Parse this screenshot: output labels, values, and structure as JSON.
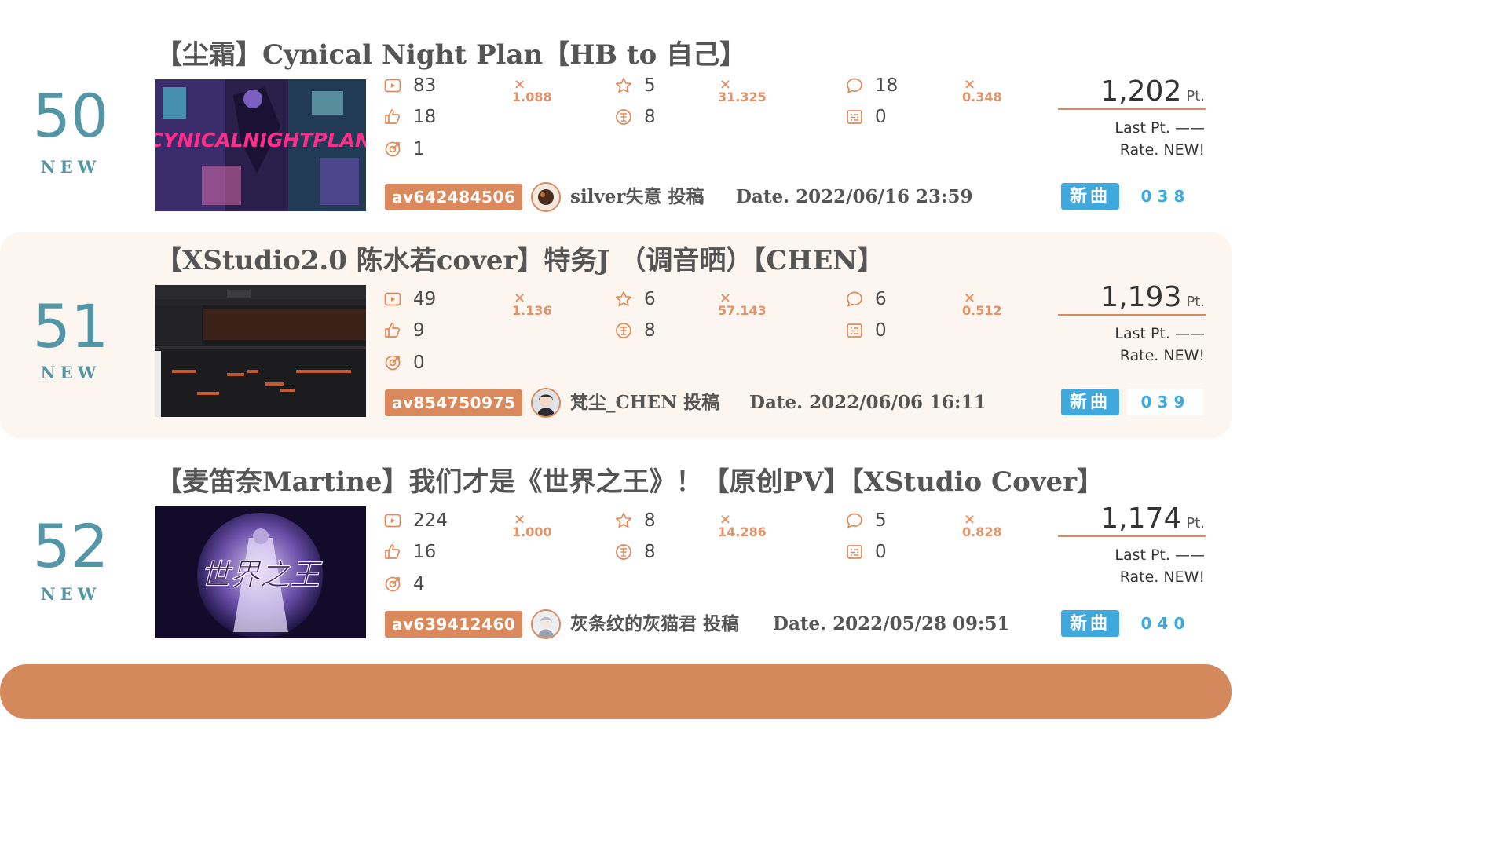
{
  "colors": {
    "accent": "#d9895c",
    "rank": "#5495a6",
    "badge": "#3fa9dd",
    "multiplier": "#e3936a"
  },
  "entries": [
    {
      "rank": "50",
      "status": "NEW",
      "title": "【尘霜】Cynical Night Plan【HB to 自己】",
      "thumbnail_text": "CYNICALNIGHTPLAN",
      "stats": {
        "views": "83",
        "likes": "18",
        "shares": "1",
        "favorites": "5",
        "coins": "8",
        "comments": "18",
        "danmaku": "0"
      },
      "multipliers": {
        "view": "1.088",
        "favorite": "31.325",
        "comment": "0.348"
      },
      "av": "av642484506",
      "uploader": "silver失意 投稿",
      "date": "Date. 2022/06/16 23:59",
      "points": "1,202",
      "unit": "Pt.",
      "last_pt": "Last Pt. ——",
      "rate": "Rate. NEW!",
      "badge": "新曲",
      "index": "038"
    },
    {
      "rank": "51",
      "status": "NEW",
      "title": "【XStudio2.0 陈水若cover】特务J （调音晒）【CHEN】",
      "thumbnail_text": "",
      "stats": {
        "views": "49",
        "likes": "9",
        "shares": "0",
        "favorites": "6",
        "coins": "8",
        "comments": "6",
        "danmaku": "0"
      },
      "multipliers": {
        "view": "1.136",
        "favorite": "57.143",
        "comment": "0.512"
      },
      "av": "av854750975",
      "uploader": "梵尘_CHEN 投稿",
      "date": "Date. 2022/06/06 16:11",
      "points": "1,193",
      "unit": "Pt.",
      "last_pt": "Last Pt. ——",
      "rate": "Rate. NEW!",
      "badge": "新曲",
      "index": "039"
    },
    {
      "rank": "52",
      "status": "NEW",
      "title": "【麦笛奈Martine】我们才是《世界之王》！【原创PV】【XStudio Cover】",
      "thumbnail_text": "世界之王",
      "stats": {
        "views": "224",
        "likes": "16",
        "shares": "4",
        "favorites": "8",
        "coins": "8",
        "comments": "5",
        "danmaku": "0"
      },
      "multipliers": {
        "view": "1.000",
        "favorite": "14.286",
        "comment": "0.828"
      },
      "av": "av639412460",
      "uploader": "灰条纹的灰猫君 投稿",
      "date": "Date. 2022/05/28 09:51",
      "points": "1,174",
      "unit": "Pt.",
      "last_pt": "Last Pt. ——",
      "rate": "Rate. NEW!",
      "badge": "新曲",
      "index": "040"
    }
  ]
}
